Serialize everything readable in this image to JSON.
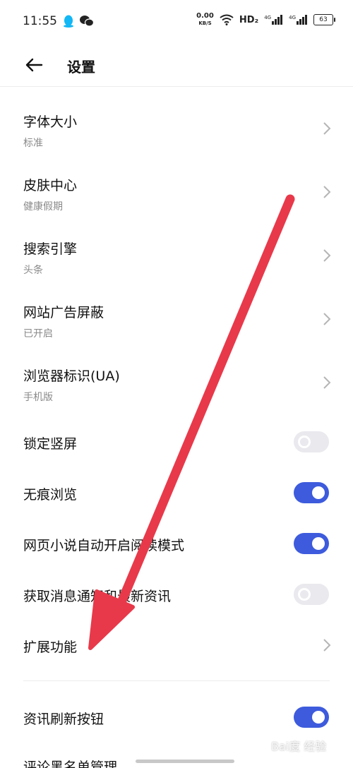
{
  "status_bar": {
    "time": "11:55",
    "net_speed_value": "0.00",
    "net_speed_unit": "KB/S",
    "hd_label": "HD₂",
    "signal1_label": "4G",
    "signal2_label": "4G",
    "battery": "63",
    "icons": [
      "qq-icon",
      "wechat-icon",
      "wifi-icon",
      "signal-icon",
      "battery-icon"
    ]
  },
  "header": {
    "title": "设置",
    "back_icon": "arrow-left-icon"
  },
  "settings": [
    {
      "label": "字体大小",
      "sub": "标准",
      "control": "chevron"
    },
    {
      "label": "皮肤中心",
      "sub": "健康假期",
      "control": "chevron"
    },
    {
      "label": "搜索引擎",
      "sub": "头条",
      "control": "chevron"
    },
    {
      "label": "网站广告屏蔽",
      "sub": "已开启",
      "control": "chevron"
    },
    {
      "label": "浏览器标识(UA)",
      "sub": "手机版",
      "control": "chevron"
    },
    {
      "label": "锁定竖屏",
      "control": "toggle",
      "on": false
    },
    {
      "label": "无痕浏览",
      "control": "toggle",
      "on": true
    },
    {
      "label": "网页小说自动开启阅读模式",
      "control": "toggle",
      "on": true
    },
    {
      "label": "获取消息通知和最新资讯",
      "control": "toggle",
      "on": false
    },
    {
      "label": "扩展功能",
      "control": "chevron"
    },
    {
      "label": "资讯刷新按钮",
      "control": "toggle",
      "on": true
    },
    {
      "label": "评论黑名单管理",
      "control": "none"
    }
  ],
  "watermark": "Bai度 经验",
  "colors": {
    "accent": "#3d5bdc",
    "toggle_off": "#e9e9ee",
    "annotation_arrow": "#e8394a"
  }
}
